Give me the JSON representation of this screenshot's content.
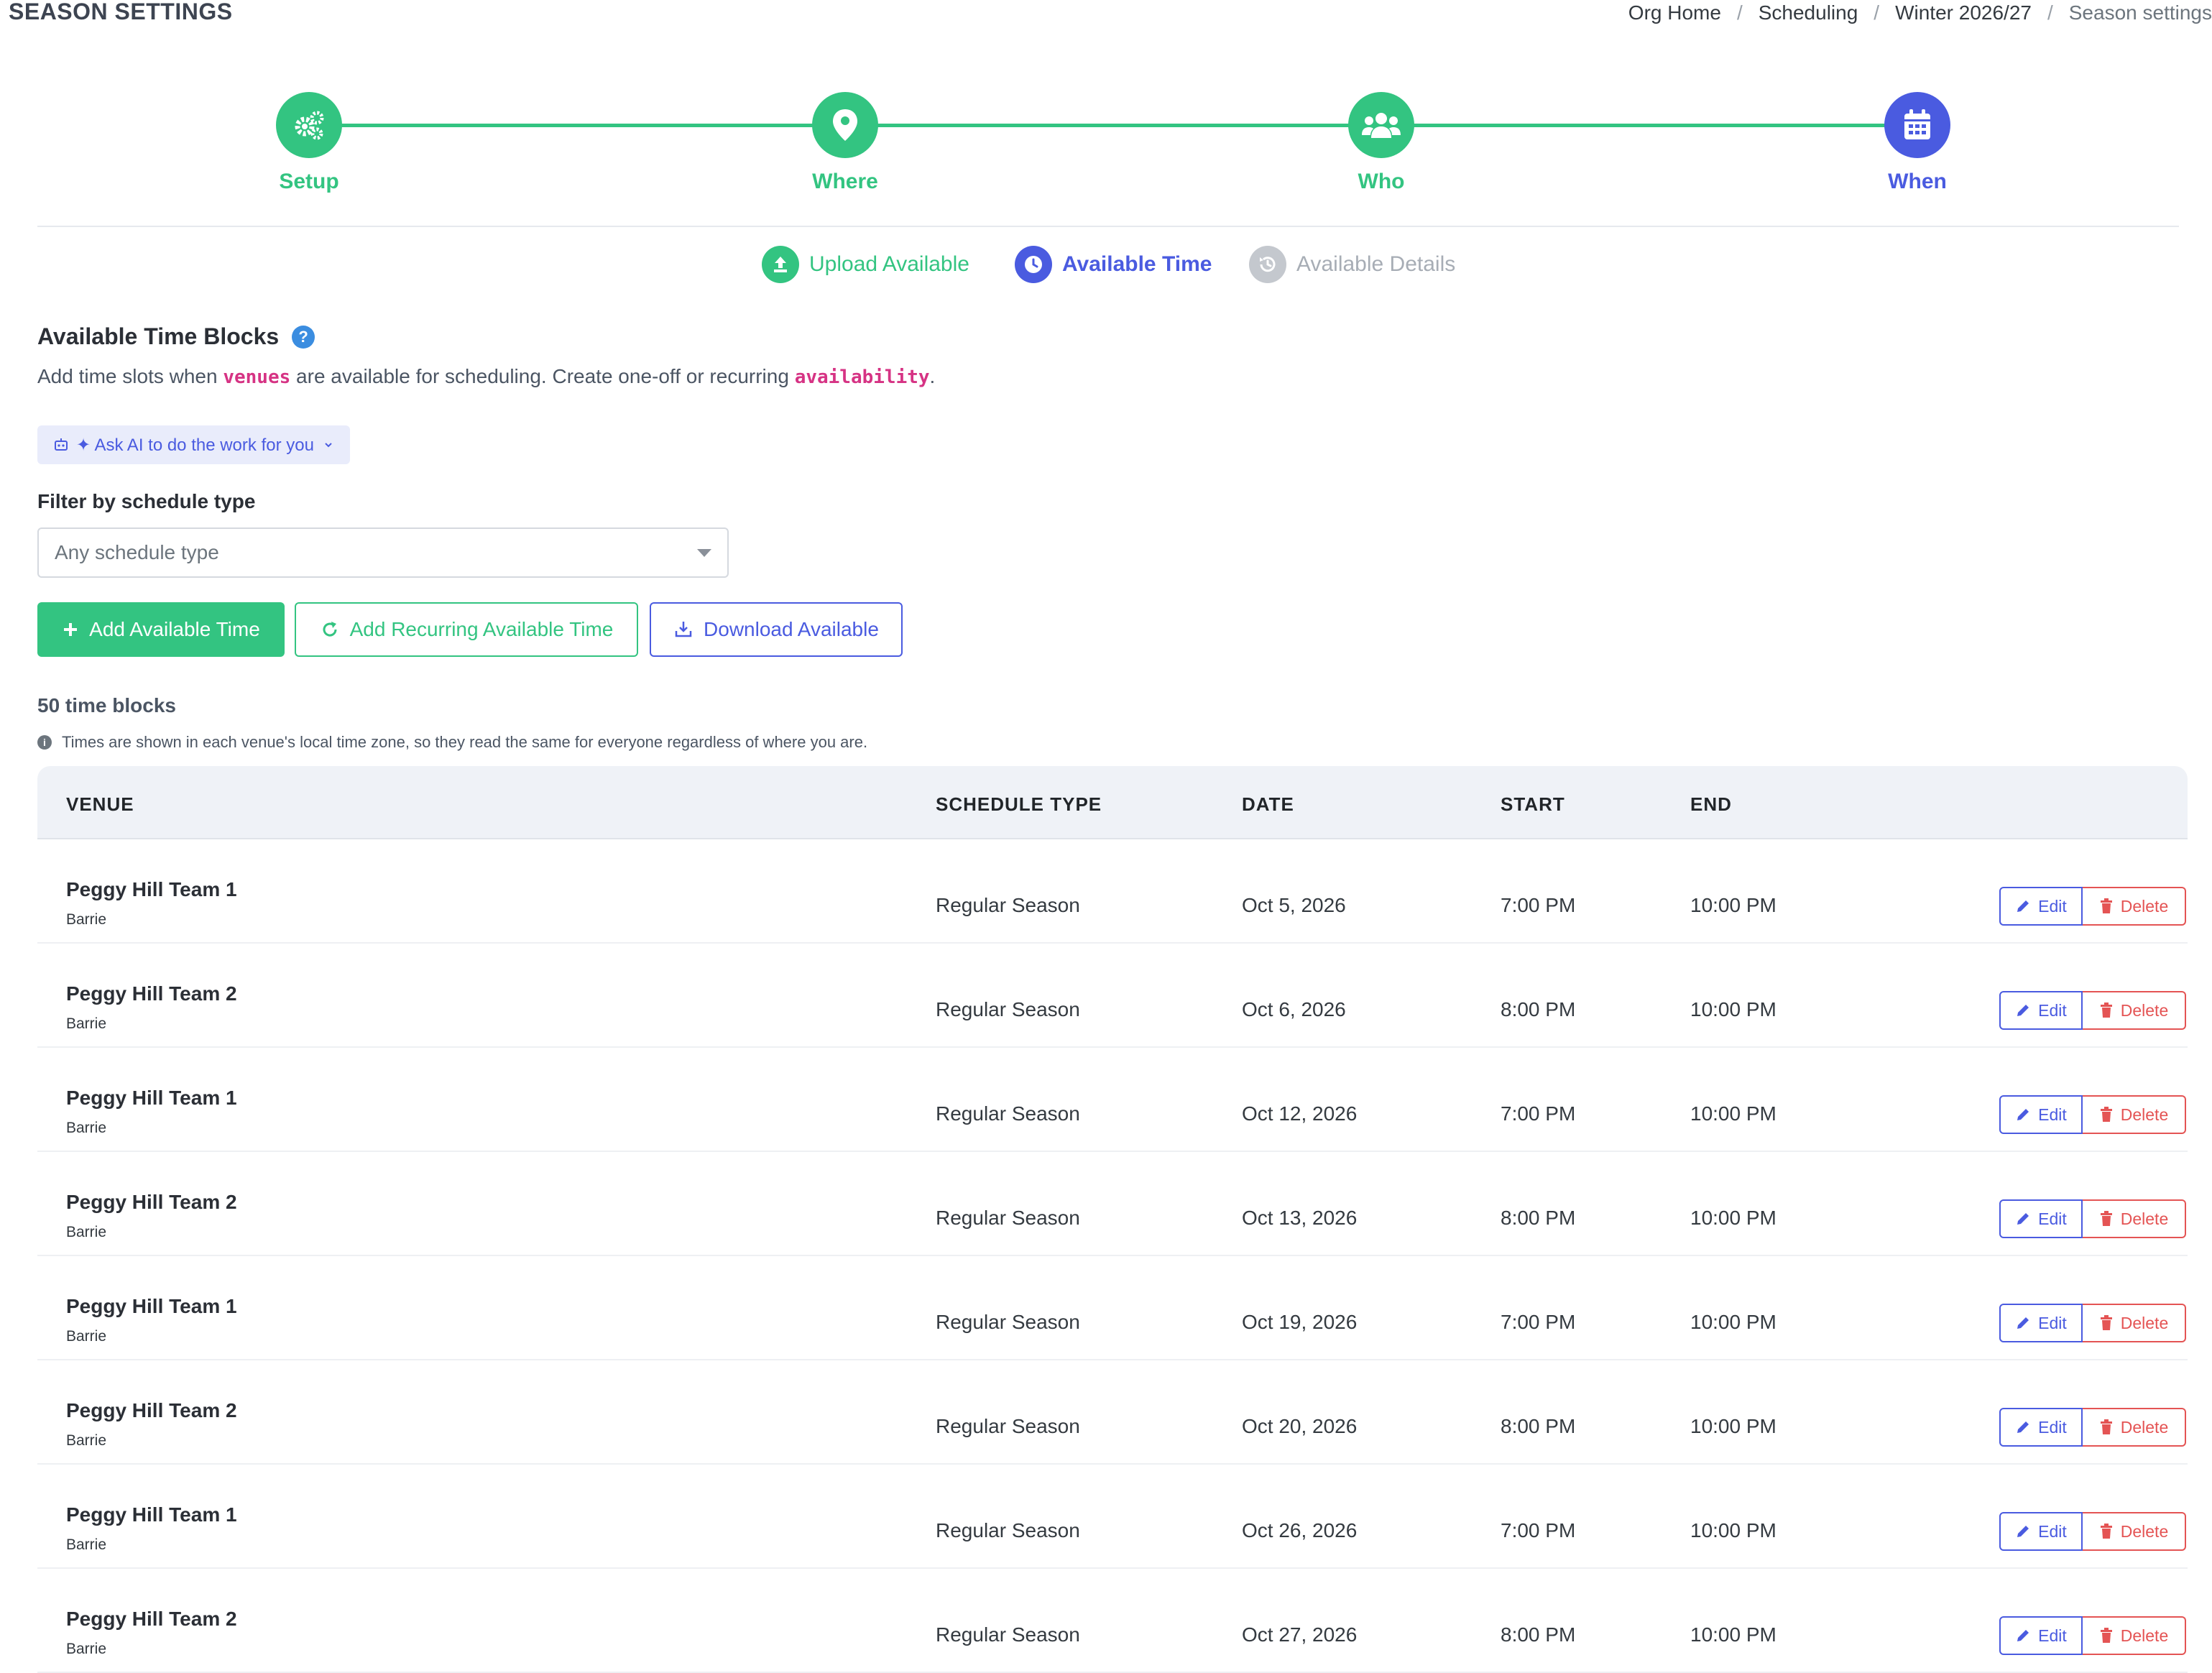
{
  "header": {
    "title": "SEASON SETTINGS",
    "breadcrumb": [
      "Org Home",
      "Scheduling",
      "Winter 2026/27",
      "Season settings"
    ]
  },
  "stepper": {
    "steps": [
      {
        "label": "Setup",
        "icon": "gears-icon",
        "state": "complete"
      },
      {
        "label": "Where",
        "icon": "map-pin-icon",
        "state": "complete"
      },
      {
        "label": "Who",
        "icon": "users-icon",
        "state": "complete"
      },
      {
        "label": "When",
        "icon": "calendar-icon",
        "state": "active"
      }
    ],
    "substeps": [
      {
        "label": "Upload Available",
        "icon": "upload-icon",
        "state": "complete"
      },
      {
        "label": "Available Time",
        "icon": "clock-icon",
        "state": "active"
      },
      {
        "label": "Available Details",
        "icon": "history-icon",
        "state": "inactive"
      }
    ]
  },
  "section": {
    "title": "Available Time Blocks",
    "help_icon": "?",
    "desc_before": "Add time slots when ",
    "desc_code1": "venues",
    "desc_middle": " are available for scheduling. Create one-off or recurring ",
    "desc_code2": "availability",
    "desc_after": "."
  },
  "ai_button": {
    "label": "✦ Ask AI to do the work for you"
  },
  "filter": {
    "label": "Filter by schedule type",
    "placeholder": "Any schedule type"
  },
  "actions": {
    "add": "Add Available Time",
    "recurring": "Add Recurring Available Time",
    "download": "Download Available"
  },
  "summary": {
    "count": "50 time blocks",
    "note": "Times are shown in each venue's local time zone, so they read the same for everyone regardless of where you are."
  },
  "table": {
    "columns": [
      "VENUE",
      "SCHEDULE TYPE",
      "DATE",
      "START",
      "END"
    ],
    "edit_label": "Edit",
    "delete_label": "Delete",
    "rows": [
      {
        "venue": "Peggy Hill Team 1",
        "city": "Barrie",
        "type": "Regular Season",
        "date": "Oct 5, 2026",
        "start": "7:00 PM",
        "end": "10:00 PM"
      },
      {
        "venue": "Peggy Hill Team 2",
        "city": "Barrie",
        "type": "Regular Season",
        "date": "Oct 6, 2026",
        "start": "8:00 PM",
        "end": "10:00 PM"
      },
      {
        "venue": "Peggy Hill Team 1",
        "city": "Barrie",
        "type": "Regular Season",
        "date": "Oct 12, 2026",
        "start": "7:00 PM",
        "end": "10:00 PM"
      },
      {
        "venue": "Peggy Hill Team 2",
        "city": "Barrie",
        "type": "Regular Season",
        "date": "Oct 13, 2026",
        "start": "8:00 PM",
        "end": "10:00 PM"
      },
      {
        "venue": "Peggy Hill Team 1",
        "city": "Barrie",
        "type": "Regular Season",
        "date": "Oct 19, 2026",
        "start": "7:00 PM",
        "end": "10:00 PM"
      },
      {
        "venue": "Peggy Hill Team 2",
        "city": "Barrie",
        "type": "Regular Season",
        "date": "Oct 20, 2026",
        "start": "8:00 PM",
        "end": "10:00 PM"
      },
      {
        "venue": "Peggy Hill Team 1",
        "city": "Barrie",
        "type": "Regular Season",
        "date": "Oct 26, 2026",
        "start": "7:00 PM",
        "end": "10:00 PM"
      },
      {
        "venue": "Peggy Hill Team 2",
        "city": "Barrie",
        "type": "Regular Season",
        "date": "Oct 27, 2026",
        "start": "8:00 PM",
        "end": "10:00 PM"
      }
    ]
  },
  "colors": {
    "green": "#33c481",
    "blue": "#4a5be0",
    "red": "#e45454",
    "pink_code": "#d63384"
  }
}
